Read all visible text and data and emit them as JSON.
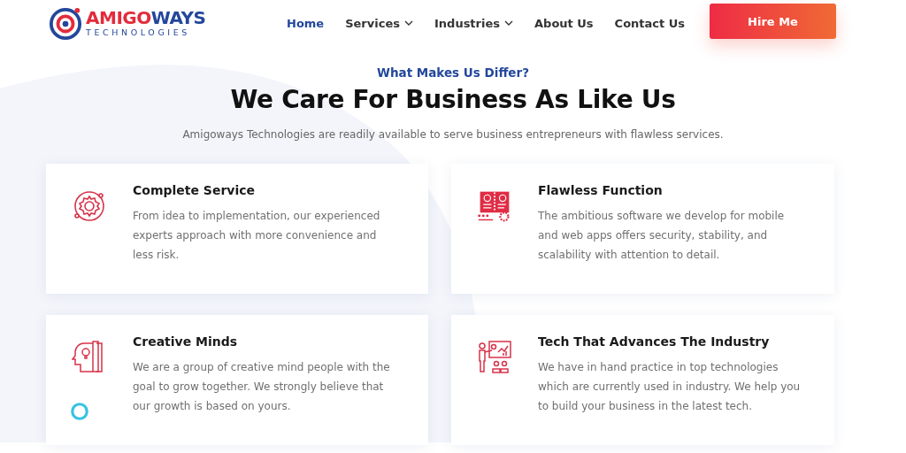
{
  "logo": {
    "name_a": "AMIGO",
    "name_b": "WAYS",
    "tagline": "TECHNOLOGIES"
  },
  "nav": [
    {
      "label": "Home",
      "selected": true,
      "dropdown": false
    },
    {
      "label": "Services",
      "selected": false,
      "dropdown": true
    },
    {
      "label": "Industries",
      "selected": false,
      "dropdown": true
    },
    {
      "label": "About Us",
      "selected": false,
      "dropdown": false
    },
    {
      "label": "Contact Us",
      "selected": false,
      "dropdown": false
    }
  ],
  "cta": "Hire Me",
  "section": {
    "eyebrow": "What Makes Us Differ?",
    "title": "We Care For Business As Like Us",
    "subtitle": "Amigoways Technologies are readily available to serve business entrepreneurs with flawless services."
  },
  "cards": [
    {
      "kind": "gear",
      "title": "Complete Service",
      "text": "From idea to implementation, our experienced experts approach with more convenience and less risk."
    },
    {
      "kind": "dashboard",
      "title": "Flawless Function",
      "text": "The ambitious software we develop for mobile and web apps offers security, stability, and scalability with attention to detail."
    },
    {
      "kind": "mind",
      "title": "Creative Minds",
      "text": "We are a group of creative mind people with the goal to grow together. We strongly believe that our growth is based on yours."
    },
    {
      "kind": "presentation",
      "title": "Tech That Advances The Industry",
      "text": "We have in hand practice in top technologies which are currently used in industry. We help you to build your business in the latest tech."
    }
  ]
}
